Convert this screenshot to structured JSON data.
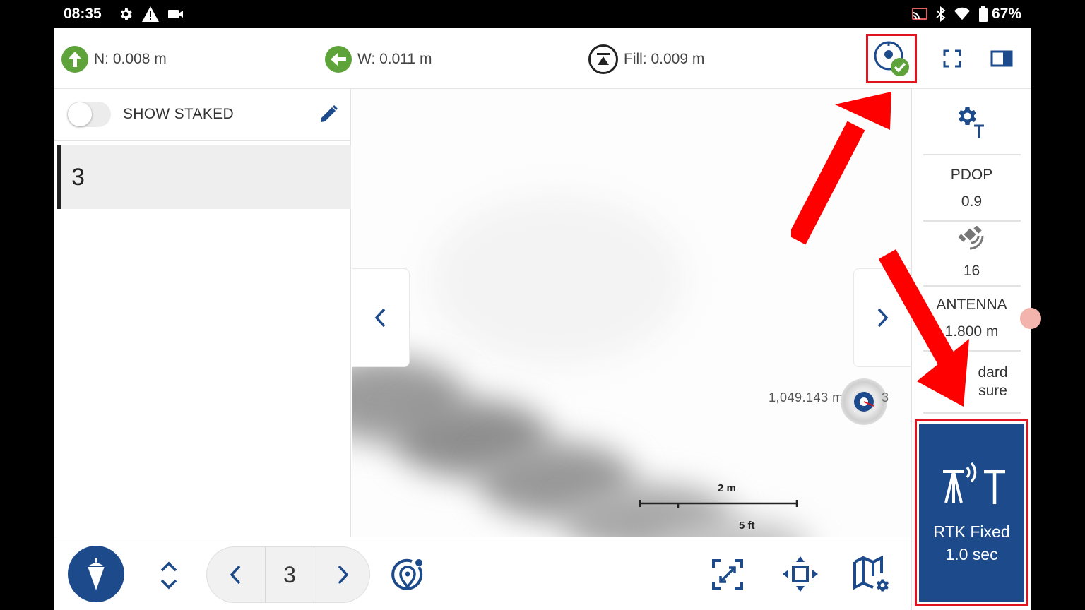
{
  "status_bar": {
    "time": "08:35",
    "battery": "67%",
    "icons_left": [
      "settings-icon",
      "warning-icon",
      "video-camera-icon"
    ],
    "icons_right": [
      "cast-icon",
      "bluetooth-icon",
      "wifi-icon",
      "battery-icon"
    ]
  },
  "top_bar": {
    "north": "N: 0.008 m",
    "west": "W: 0.011 m",
    "fill": "Fill: 0.009 m"
  },
  "list_panel": {
    "toggle_label": "SHOW STAKED",
    "toggle_on": false,
    "items": [
      {
        "label": "3"
      }
    ]
  },
  "map": {
    "target_distance": "1,049.143 m",
    "target_label": "3",
    "scale_m": "2 m",
    "scale_ft": "5 ft"
  },
  "info_panel": {
    "pdop_label": "PDOP",
    "pdop_value": "0.9",
    "satellites": "16",
    "antenna_label": "ANTENNA",
    "antenna_value": "1.800 m",
    "method_line1": "dard",
    "method_line2": "sure",
    "rtk_status": "RTK Fixed",
    "rtk_interval": "1.0 sec"
  },
  "bottom_bar": {
    "current_point": "3"
  },
  "colors": {
    "brand_blue": "#1c4a8b",
    "arrow_green": "#5ea33a",
    "annotation_red": "#e0141e"
  }
}
